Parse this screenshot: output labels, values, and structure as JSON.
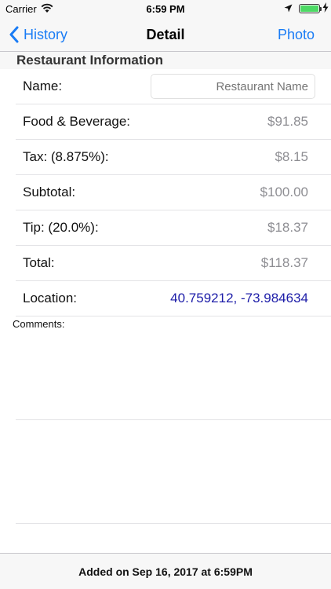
{
  "status_bar": {
    "carrier": "Carrier",
    "time": "6:59 PM",
    "icons": [
      "wifi-icon",
      "location-arrow-icon",
      "battery-icon",
      "charging-bolt-icon"
    ],
    "battery_color": "#4cd964"
  },
  "nav": {
    "back_label": "History",
    "title": "Detail",
    "right_label": "Photo",
    "tint_color": "#1a7cf5"
  },
  "section": {
    "title": "Restaurant Information"
  },
  "form": {
    "name_label": "Name:",
    "name_placeholder": "Restaurant Name",
    "name_value": "",
    "rows": [
      {
        "label": "Food & Beverage:",
        "value": "$91.85"
      },
      {
        "label": "Tax: (8.875%):",
        "value": "$8.15"
      },
      {
        "label": "Subtotal:",
        "value": "$100.00"
      },
      {
        "label": "Tip: (20.0%):",
        "value": "$18.37"
      },
      {
        "label": "Total:",
        "value": "$118.37"
      }
    ],
    "location_label": "Location:",
    "location_value": "40.759212, -73.984634",
    "location_color": "#1c1ca8"
  },
  "comments": {
    "label": "Comments:",
    "value": ""
  },
  "footer": {
    "text": "Added on Sep 16, 2017 at 6:59PM"
  }
}
